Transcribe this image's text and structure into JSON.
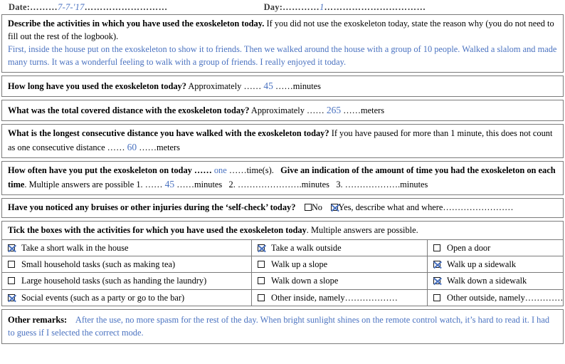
{
  "header": {
    "date_label": "Date:",
    "date_dots_before": "………",
    "date_value": "7-7-'17",
    "date_dots_after": "………………………",
    "day_label": "Day:",
    "day_dots_before": "…………",
    "day_value": "1",
    "day_dots_after": "……………………………"
  },
  "describe": {
    "question": "Describe the activities in which you have used the exoskeleton today.",
    "instruction": "If you did not use the exoskeleton today, state the reason why (you do not need to fill out the rest of the logbook).",
    "answer": "First, inside the house put on the exoskeleton to show it to friends. Then we walked around the house with a group of 10 people. Walked a slalom and made many turns. It was a wonderful feeling to walk with a group of friends. I really enjoyed it today."
  },
  "duration": {
    "question": "How long have you used the exoskeleton today?",
    "prefix": "Approximately ……",
    "value": "45",
    "suffix": "……minutes"
  },
  "distance": {
    "question": "What was the total covered distance with the exoskeleton today?",
    "prefix": "Approximately ……",
    "value": "265",
    "suffix": "……meters"
  },
  "consecutive": {
    "question": "What is the longest consecutive distance you have walked with the exoskeleton today?",
    "instruction": "If you have paused for more than 1 minute, this does not count as one consecutive distance ……",
    "value": "60",
    "suffix": "……meters"
  },
  "frequency": {
    "question_a": "How often have you put the exoskeleton on today ……",
    "times_value": "one",
    "question_a_suffix": "……time(s).",
    "question_b": "Give an indication of the amount of time you had the exoskeleton on each time",
    "note": ". Multiple answers are possible",
    "item1_label": "1. ……",
    "item1_value": "45",
    "item1_suffix": "……minutes",
    "item2": "2. ………………….minutes",
    "item3": "3. ……………….minutes"
  },
  "bruises": {
    "question": "Have you noticed any bruises or other injuries during the ‘self-check’ today?",
    "no_label": "No",
    "no_checked": false,
    "yes_label": "Yes, describe what and where……………………",
    "yes_checked": true
  },
  "activities": {
    "heading_bold": "Tick the boxes with the activities for which you have used the exoskeleton today",
    "heading_rest": ". Multiple answers are possible.",
    "rows": [
      [
        {
          "label": "Take a short walk in the house",
          "checked": true
        },
        {
          "label": "Take a walk outside",
          "checked": true
        },
        {
          "label": "Open a door",
          "checked": false
        }
      ],
      [
        {
          "label": "Small household tasks (such as making tea)",
          "checked": false
        },
        {
          "label": "Walk up a slope",
          "checked": false
        },
        {
          "label": "Walk up a sidewalk",
          "checked": true
        }
      ],
      [
        {
          "label": "Large household tasks (such as handing the laundry)",
          "checked": false
        },
        {
          "label": "Walk down a slope",
          "checked": false
        },
        {
          "label": "Walk down a sidewalk",
          "checked": true
        }
      ],
      [
        {
          "label": "Social events (such as a party or go to the bar)",
          "checked": true
        },
        {
          "label": "Other inside, namely………………",
          "checked": false
        },
        {
          "label": "Other outside, namely………………",
          "checked": false
        }
      ]
    ]
  },
  "remarks": {
    "label": "Other remarks:",
    "text": "After the use, no more spasm for the rest of the day. When bright sunlight shines on the remote control watch, it’s hard to read it. I had to guess if I selected the correct mode."
  },
  "colors": {
    "ink_blue": "#4a72c0",
    "border_gray": "#7b7b7b"
  }
}
